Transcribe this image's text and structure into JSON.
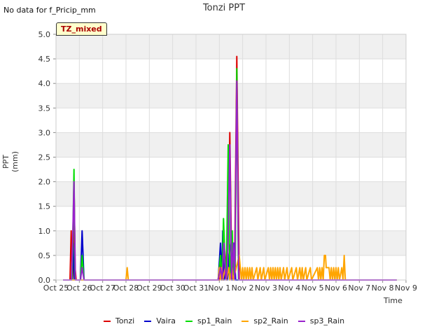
{
  "no_data_text": "No data for f_Pricip_mm",
  "badge_text": "TZ_mixed",
  "chart_data": {
    "type": "line",
    "title": "Tonzi PPT",
    "xlabel": "Time",
    "ylabel": "PPT (mm)",
    "ylim": [
      0.0,
      5.0
    ],
    "yticks": [
      "0.0",
      "0.5",
      "1.0",
      "1.5",
      "2.0",
      "2.5",
      "3.0",
      "3.5",
      "4.0",
      "4.5",
      "5.0"
    ],
    "xlim": [
      0,
      15
    ],
    "xticks": [
      "Oct 25",
      "Oct 26",
      "Oct 27",
      "Oct 28",
      "Oct 29",
      "Oct 30",
      "Oct 31",
      "Nov 1",
      "Nov 2",
      "Nov 3",
      "Nov 4",
      "Nov 5",
      "Nov 6",
      "Nov 7",
      "Nov 8",
      "Nov 9"
    ],
    "grid": true,
    "legend_position": "bottom",
    "series": [
      {
        "name": "Tonzi",
        "color": "#dd0000",
        "points": [
          [
            0.3,
            0
          ],
          [
            0.6,
            0
          ],
          [
            0.65,
            1.0
          ],
          [
            0.7,
            0
          ],
          [
            0.74,
            0.5
          ],
          [
            0.77,
            2.0
          ],
          [
            0.82,
            0.25
          ],
          [
            0.86,
            0
          ],
          [
            7.0,
            0
          ],
          [
            7.1,
            0.5
          ],
          [
            7.2,
            0
          ],
          [
            7.3,
            0.5
          ],
          [
            7.38,
            1.0
          ],
          [
            7.45,
            3.0
          ],
          [
            7.52,
            0.5
          ],
          [
            7.6,
            0.25
          ],
          [
            7.65,
            0
          ],
          [
            7.75,
            4.55
          ],
          [
            7.85,
            0
          ],
          [
            14.6,
            0
          ]
        ]
      },
      {
        "name": "Vaira",
        "color": "#0000cc",
        "points": [
          [
            0.3,
            0
          ],
          [
            0.68,
            0
          ],
          [
            0.73,
            0.75
          ],
          [
            0.78,
            0
          ],
          [
            1.05,
            0
          ],
          [
            1.12,
            1.0
          ],
          [
            1.2,
            0
          ],
          [
            6.95,
            0
          ],
          [
            7.05,
            0.75
          ],
          [
            7.1,
            0
          ],
          [
            7.15,
            1.0
          ],
          [
            7.2,
            0
          ],
          [
            7.28,
            0.25
          ],
          [
            7.35,
            0
          ],
          [
            7.42,
            0.5
          ],
          [
            7.5,
            0.75
          ],
          [
            7.55,
            0
          ],
          [
            7.62,
            0.75
          ],
          [
            7.7,
            0
          ],
          [
            14.6,
            0
          ]
        ]
      },
      {
        "name": "sp1_Rain",
        "color": "#00dd00",
        "points": [
          [
            0.3,
            0
          ],
          [
            0.68,
            0
          ],
          [
            0.72,
            0.75
          ],
          [
            0.77,
            2.25
          ],
          [
            0.82,
            0
          ],
          [
            1.05,
            0
          ],
          [
            1.12,
            0.5
          ],
          [
            1.2,
            0
          ],
          [
            6.95,
            0
          ],
          [
            7.05,
            0.5
          ],
          [
            7.12,
            0
          ],
          [
            7.18,
            1.25
          ],
          [
            7.25,
            0.25
          ],
          [
            7.3,
            0
          ],
          [
            7.38,
            2.75
          ],
          [
            7.45,
            0
          ],
          [
            7.55,
            1.0
          ],
          [
            7.6,
            0
          ],
          [
            7.68,
            0.25
          ],
          [
            7.75,
            4.3
          ],
          [
            7.82,
            0
          ],
          [
            14.6,
            0
          ]
        ]
      },
      {
        "name": "sp2_Rain",
        "color": "#ffa500",
        "points": [
          [
            0.3,
            0
          ],
          [
            3.0,
            0
          ],
          [
            3.05,
            0.25
          ],
          [
            3.1,
            0
          ],
          [
            6.95,
            0
          ],
          [
            7.0,
            0.25
          ],
          [
            7.05,
            0
          ],
          [
            7.1,
            0.25
          ],
          [
            7.15,
            0
          ],
          [
            7.25,
            0.25
          ],
          [
            7.3,
            0
          ],
          [
            7.4,
            0.25
          ],
          [
            7.45,
            0
          ],
          [
            7.55,
            0.25
          ],
          [
            7.6,
            0
          ],
          [
            7.85,
            0.5
          ],
          [
            7.9,
            0.25
          ],
          [
            7.95,
            0
          ],
          [
            8.0,
            0.25
          ],
          [
            8.05,
            0
          ],
          [
            8.1,
            0.25
          ],
          [
            8.15,
            0
          ],
          [
            8.2,
            0.25
          ],
          [
            8.25,
            0
          ],
          [
            8.3,
            0.25
          ],
          [
            8.35,
            0
          ],
          [
            8.4,
            0.25
          ],
          [
            8.45,
            0
          ],
          [
            8.6,
            0.25
          ],
          [
            8.65,
            0
          ],
          [
            8.75,
            0.25
          ],
          [
            8.8,
            0
          ],
          [
            8.9,
            0.25
          ],
          [
            8.95,
            0
          ],
          [
            9.1,
            0.25
          ],
          [
            9.15,
            0
          ],
          [
            9.2,
            0.25
          ],
          [
            9.25,
            0
          ],
          [
            9.3,
            0.25
          ],
          [
            9.35,
            0
          ],
          [
            9.4,
            0.25
          ],
          [
            9.45,
            0
          ],
          [
            9.5,
            0.25
          ],
          [
            9.55,
            0
          ],
          [
            9.6,
            0.25
          ],
          [
            9.65,
            0
          ],
          [
            9.75,
            0.25
          ],
          [
            9.8,
            0
          ],
          [
            9.9,
            0.25
          ],
          [
            9.95,
            0
          ],
          [
            10.1,
            0.25
          ],
          [
            10.15,
            0
          ],
          [
            10.3,
            0.25
          ],
          [
            10.35,
            0
          ],
          [
            10.45,
            0.25
          ],
          [
            10.5,
            0
          ],
          [
            10.55,
            0.25
          ],
          [
            10.6,
            0
          ],
          [
            10.7,
            0.25
          ],
          [
            10.75,
            0
          ],
          [
            10.9,
            0.25
          ],
          [
            10.95,
            0
          ],
          [
            11.2,
            0.25
          ],
          [
            11.25,
            0
          ],
          [
            11.3,
            0.25
          ],
          [
            11.35,
            0
          ],
          [
            11.4,
            0.25
          ],
          [
            11.45,
            0
          ],
          [
            11.5,
            0.5
          ],
          [
            11.55,
            0.5
          ],
          [
            11.58,
            0.25
          ],
          [
            11.7,
            0.25
          ],
          [
            11.75,
            0
          ],
          [
            11.8,
            0.25
          ],
          [
            11.85,
            0
          ],
          [
            11.9,
            0.25
          ],
          [
            11.95,
            0
          ],
          [
            12.0,
            0.25
          ],
          [
            12.05,
            0
          ],
          [
            12.1,
            0.25
          ],
          [
            12.15,
            0
          ],
          [
            12.25,
            0.25
          ],
          [
            12.3,
            0
          ],
          [
            12.35,
            0.5
          ],
          [
            12.4,
            0
          ],
          [
            14.6,
            0
          ]
        ]
      },
      {
        "name": "sp3_Rain",
        "color": "#9922cc",
        "points": [
          [
            0.3,
            0
          ],
          [
            0.66,
            0
          ],
          [
            0.71,
            0.75
          ],
          [
            0.77,
            2.0
          ],
          [
            0.83,
            0
          ],
          [
            1.05,
            0
          ],
          [
            1.12,
            0.25
          ],
          [
            1.2,
            0
          ],
          [
            6.95,
            0
          ],
          [
            7.05,
            0.25
          ],
          [
            7.12,
            0
          ],
          [
            7.2,
            0.75
          ],
          [
            7.28,
            0
          ],
          [
            7.35,
            0.25
          ],
          [
            7.45,
            2.75
          ],
          [
            7.52,
            0
          ],
          [
            7.6,
            0.75
          ],
          [
            7.66,
            0
          ],
          [
            7.75,
            4.05
          ],
          [
            7.83,
            0
          ],
          [
            14.6,
            0
          ]
        ]
      }
    ]
  }
}
